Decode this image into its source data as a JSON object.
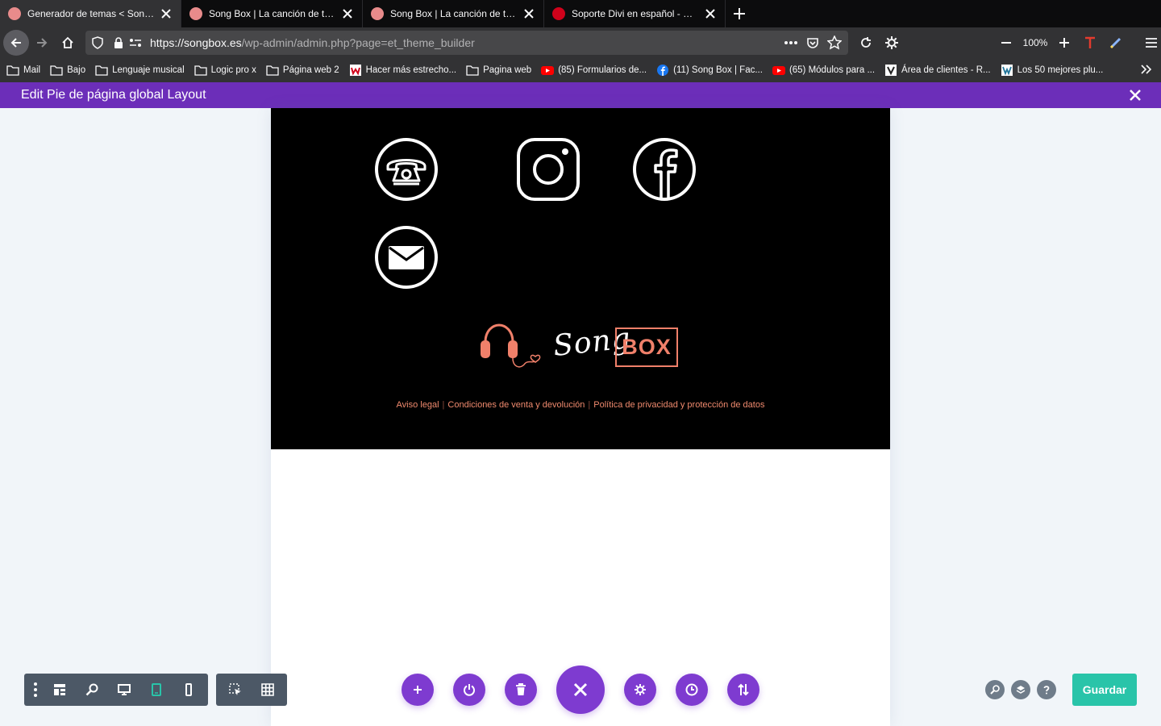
{
  "browser": {
    "tabs": [
      {
        "title": "Generador de temas < Song Box",
        "active": true,
        "favicon_color": "#e88b8b"
      },
      {
        "title": "Song Box | La canción de tu vida",
        "active": false,
        "favicon_color": "#e88b8b"
      },
      {
        "title": "Song Box | La canción de tu vida",
        "active": false,
        "favicon_color": "#e88b8b"
      },
      {
        "title": "Soporte Divi en español - WPFácil",
        "active": false,
        "favicon_color": "#d0021b"
      }
    ],
    "url_domain": "https://songbox.es",
    "url_path": "/wp-admin/admin.php?page=et_theme_builder",
    "zoom": "100%",
    "bookmarks": [
      {
        "label": "Mail",
        "icon": "folder-icon"
      },
      {
        "label": "Bajo",
        "icon": "folder-icon"
      },
      {
        "label": "Lenguaje musical",
        "icon": "folder-icon"
      },
      {
        "label": "Logic pro x",
        "icon": "folder-icon"
      },
      {
        "label": "Página web 2",
        "icon": "folder-icon"
      },
      {
        "label": "Hacer más estrecho...",
        "icon": "wpfacil-icon"
      },
      {
        "label": "Pagina web",
        "icon": "folder-icon"
      },
      {
        "label": "(85) Formularios de...",
        "icon": "youtube-icon"
      },
      {
        "label": "(11) Song Box | Fac...",
        "icon": "facebook-icon"
      },
      {
        "label": "(65) Módulos para ...",
        "icon": "youtube-icon"
      },
      {
        "label": "Área de clientes - R...",
        "icon": "raiola-icon"
      },
      {
        "label": "Los 50 mejores plu...",
        "icon": "wordpress-icon"
      }
    ]
  },
  "divi": {
    "title": "Edit Pie de página global Layout",
    "save_label": "Guardar",
    "accent": "#6c2eb9",
    "save_color": "#29c4a9"
  },
  "footer": {
    "social_icons": [
      "phone-icon",
      "instagram-icon",
      "facebook-icon",
      "email-icon"
    ],
    "logo_text_script": "Song",
    "logo_text_box": "BOX",
    "legal_links": [
      "Aviso legal",
      "Condiciones de venta y devolución",
      "Política de privacidad y protección de datos"
    ],
    "link_color": "#f08a6e"
  }
}
